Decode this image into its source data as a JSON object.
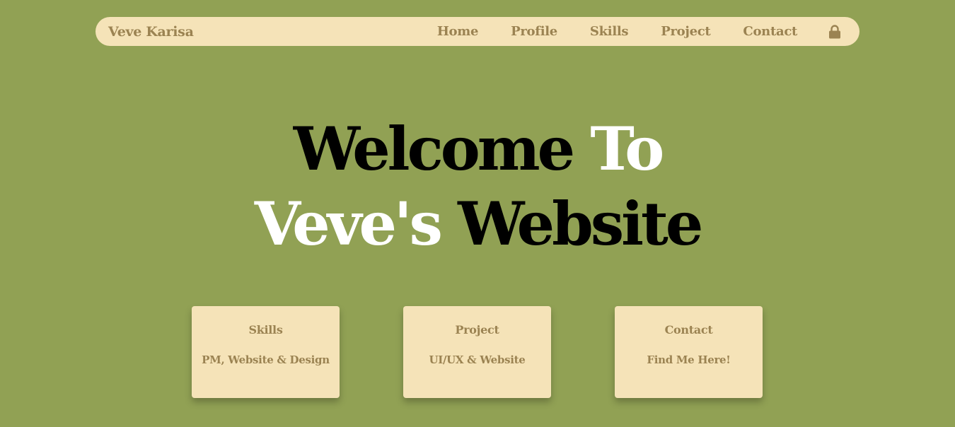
{
  "colors": {
    "background": "#91a154",
    "navbar": "#f5e3b8",
    "accent_text": "#9b8352",
    "hero_dark": "#000000",
    "hero_light": "#ffffff"
  },
  "navbar": {
    "brand": "Veve Karisa",
    "links": [
      {
        "label": "Home"
      },
      {
        "label": "Profile"
      },
      {
        "label": "Skills"
      },
      {
        "label": "Project"
      },
      {
        "label": "Contact"
      }
    ],
    "icon": "lock-icon"
  },
  "hero": {
    "line1_part1": "Welcome",
    "line1_part2": "To",
    "line2_part1": "Veve's",
    "line2_part2": "Website"
  },
  "cards": [
    {
      "title": "Skills",
      "text": "PM, Website & Design"
    },
    {
      "title": "Project",
      "text": "UI/UX & Website"
    },
    {
      "title": "Contact",
      "text": "Find Me Here!"
    }
  ]
}
